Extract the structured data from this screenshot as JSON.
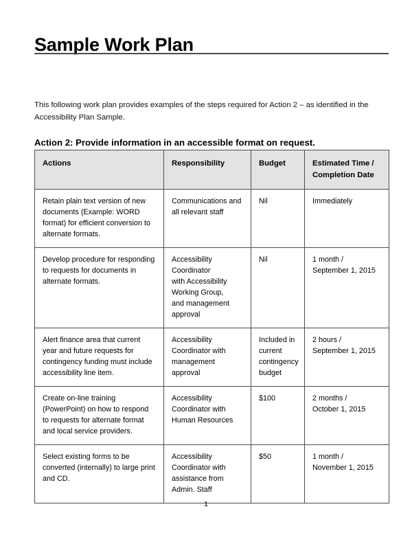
{
  "document": {
    "title": "Sample Work Plan",
    "intro": "This following work plan provides examples of the steps required for Action 2 – as identified in the Accessibility Plan Sample.",
    "action_heading": "Action 2:  Provide information in an accessible format on request.",
    "page_number": "1"
  },
  "table": {
    "columns": [
      "Actions",
      "Responsibility",
      "Budget",
      "Estimated Time / Completion Date"
    ],
    "rows": [
      {
        "actions": "Retain plain text version of new documents (Example: WORD format) for efficient conversion to alternate formats.",
        "responsibility": "Communications and all relevant staff",
        "budget": "Nil",
        "estimated_time": "Immediately"
      },
      {
        "actions": "Develop procedure for responding to requests for documents in alternate formats.",
        "responsibility": "Accessibility Coordinator\nwith Accessibility Working Group,\nand management approval",
        "budget": "Nil",
        "estimated_time": "1 month /\nSeptember 1, 2015"
      },
      {
        "actions": "Alert finance area that current year and future requests for contingency funding must include accessibility line item.",
        "responsibility": "Accessibility Coordinator with management approval",
        "budget": "Included in current contingency budget",
        "estimated_time": "2 hours /\nSeptember 1, 2015"
      },
      {
        "actions": "Create on-line training (PowerPoint) on how to respond to requests for alternate format and local service providers.",
        "responsibility": "Accessibility Coordinator with Human Resources",
        "budget": "$100",
        "estimated_time": "2 months /\nOctober 1, 2015"
      },
      {
        "actions": "Select existing forms to be converted (internally) to large print and CD.",
        "responsibility": "Accessibility Coordinator with assistance from Admin. Staff",
        "budget": "$50",
        "estimated_time": "1 month /\nNovember 1, 2015"
      }
    ]
  },
  "colors": {
    "header_background": "#e3e3e3",
    "border": "#4c4c4c",
    "rule": "#4a4a4a",
    "text": "#000000"
  }
}
